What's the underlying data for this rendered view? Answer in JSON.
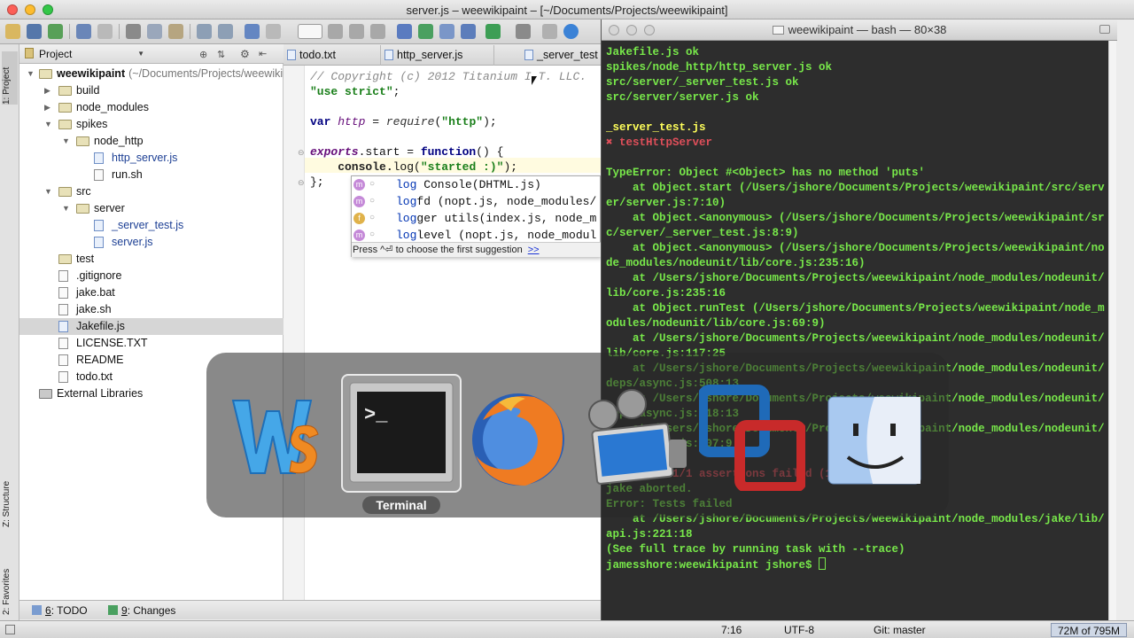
{
  "window": {
    "title": "server.js – weewikipaint – [~/Documents/Projects/weewikipaint]"
  },
  "left_strip": {
    "project_tab": "1: Project",
    "structure_tab": "Z: Structure",
    "favorites_tab": "2: Favorites"
  },
  "project_panel": {
    "selector": "Project",
    "tree": [
      {
        "label": "weewikipaint",
        "hint": "(~/Documents/Projects/weewikipaint)",
        "type": "folder",
        "depth": 0,
        "expanded": true
      },
      {
        "label": "build",
        "type": "folder",
        "depth": 1,
        "expanded": false
      },
      {
        "label": "node_modules",
        "type": "folder",
        "depth": 1,
        "expanded": false
      },
      {
        "label": "spikes",
        "type": "folder",
        "depth": 1,
        "expanded": true
      },
      {
        "label": "node_http",
        "type": "folder",
        "depth": 2,
        "expanded": true
      },
      {
        "label": "http_server.js",
        "type": "js",
        "depth": 3
      },
      {
        "label": "run.sh",
        "type": "file",
        "depth": 3
      },
      {
        "label": "src",
        "type": "folder",
        "depth": 1,
        "expanded": true
      },
      {
        "label": "server",
        "type": "folder",
        "depth": 2,
        "expanded": true
      },
      {
        "label": "_server_test.js",
        "type": "js",
        "depth": 3
      },
      {
        "label": "server.js",
        "type": "js",
        "depth": 3
      },
      {
        "label": "test",
        "type": "folder",
        "depth": 1,
        "leaf": true
      },
      {
        "label": ".gitignore",
        "type": "file",
        "depth": 1
      },
      {
        "label": "jake.bat",
        "type": "file",
        "depth": 1
      },
      {
        "label": "jake.sh",
        "type": "file",
        "depth": 1
      },
      {
        "label": "Jakefile.js",
        "type": "js",
        "depth": 1,
        "selected": true
      },
      {
        "label": "LICENSE.TXT",
        "type": "file",
        "depth": 1
      },
      {
        "label": "README",
        "type": "file",
        "depth": 1
      },
      {
        "label": "todo.txt",
        "type": "file",
        "depth": 1
      },
      {
        "label": "External Libraries",
        "type": "lib",
        "depth": 0
      }
    ]
  },
  "editor_tabs": [
    {
      "label": "todo.txt",
      "active": false
    },
    {
      "label": "http_server.js",
      "active": false
    },
    {
      "label": "_server_test",
      "active": false
    }
  ],
  "code": {
    "line1": "// Copyright (c) 2012 Titanium I.T. LLC.",
    "line2_str": "\"use strict\"",
    "line2_end": ";",
    "line4_kw": "var",
    "line4_var": "http",
    "line4_eq": " = ",
    "line4_fn": "require",
    "line4_open": "(",
    "line4_str": "\"http\"",
    "line4_end": ");",
    "line6_a": "exports",
    "line6_b": ".start = ",
    "line6_kw": "function",
    "line6_c": "() {",
    "line7_a": "    console.",
    "line7_b": "log(",
    "line7_str": "\"started :)\"",
    "line7_c": ");",
    "line8": "};"
  },
  "completion": {
    "items": [
      {
        "badge": "m",
        "match": "log",
        "rest": " Console(DHTML.js)"
      },
      {
        "badge": "m",
        "match": "log",
        "rest": "fd (nopt.js, node_modules/"
      },
      {
        "badge": "f",
        "match": "log",
        "rest": "ger utils(index.js, node_m"
      },
      {
        "badge": "m",
        "match": "log",
        "rest": "level (nopt.js, node_modul"
      }
    ],
    "footer": "Press ^⏎ to choose the first suggestion",
    "footer_link": ">>"
  },
  "bottom_tabs": [
    {
      "num": "6",
      "label": ": TODO"
    },
    {
      "num": "9",
      "label": ": Changes"
    }
  ],
  "status": {
    "position": "7:16",
    "encoding": "UTF-8",
    "vcs": "Git: master",
    "memory": "72M of 795M"
  },
  "terminal": {
    "title": "weewikipaint — bash — 80×38",
    "lines": [
      {
        "t": "Jakefile.js ok",
        "c": "g"
      },
      {
        "t": "spikes/node_http/http_server.js ok",
        "c": "g"
      },
      {
        "t": "src/server/_server_test.js ok",
        "c": "g"
      },
      {
        "t": "src/server/server.js ok",
        "c": "g"
      },
      {
        "t": "",
        "c": "g"
      },
      {
        "t": "_server_test.js",
        "c": "y"
      },
      {
        "t": "✖ testHttpServer",
        "c": "r"
      },
      {
        "t": "",
        "c": "g"
      },
      {
        "t": "TypeError: Object #<Object> has no method 'puts'",
        "c": "g"
      },
      {
        "t": "    at Object.start (/Users/jshore/Documents/Projects/weewikipaint/src/server/server.js:7:10)",
        "c": "g"
      },
      {
        "t": "    at Object.<anonymous> (/Users/jshore/Documents/Projects/weewikipaint/src/server/_server_test.js:8:9)",
        "c": "g"
      },
      {
        "t": "    at Object.<anonymous> (/Users/jshore/Documents/Projects/weewikipaint/node_modules/nodeunit/lib/core.js:235:16)",
        "c": "g"
      },
      {
        "t": "    at /Users/jshore/Documents/Projects/weewikipaint/node_modules/nodeunit/lib/core.js:235:16",
        "c": "g"
      },
      {
        "t": "    at Object.runTest (/Users/jshore/Documents/Projects/weewikipaint/node_modules/nodeunit/lib/core.js:69:9)",
        "c": "g"
      },
      {
        "t": "    at /Users/jshore/Documents/Projects/weewikipaint/node_modules/nodeunit/lib/core.js:117:25",
        "c": "g"
      },
      {
        "t": "    at /Users/jshore/Documents/Projects/weewikipaint/node_modules/nodeunit/deps/async.js:508:13",
        "c": "g"
      },
      {
        "t": "    at /Users/jshore/Documents/Projects/weewikipaint/node_modules/nodeunit/deps/async.js:118:13",
        "c": "g"
      },
      {
        "t": "    at /Users/jshore/Documents/Projects/weewikipaint/node_modules/nodeunit/deps/async.js:507:9",
        "c": "g"
      },
      {
        "t": "",
        "c": "g"
      },
      {
        "t": "FAILURES: 1/1 assertions failed (14ms)",
        "c": "r"
      },
      {
        "t": "jake aborted.",
        "c": "g"
      },
      {
        "t": "Error: Tests failed",
        "c": "g"
      },
      {
        "t": "    at /Users/jshore/Documents/Projects/weewikipaint/node_modules/jake/lib/api.js:221:18",
        "c": "g"
      },
      {
        "t": "(See full trace by running task with --trace)",
        "c": "g"
      },
      {
        "t": "jamesshore:weewikipaint jshore$ ",
        "c": "g"
      }
    ]
  },
  "app_switcher": {
    "selected_label": "Terminal",
    "apps": [
      "webstorm-icon",
      "terminal-icon",
      "firefox-icon",
      "screenflow-icon",
      "vmware-fusion-icon",
      "finder-icon"
    ]
  }
}
